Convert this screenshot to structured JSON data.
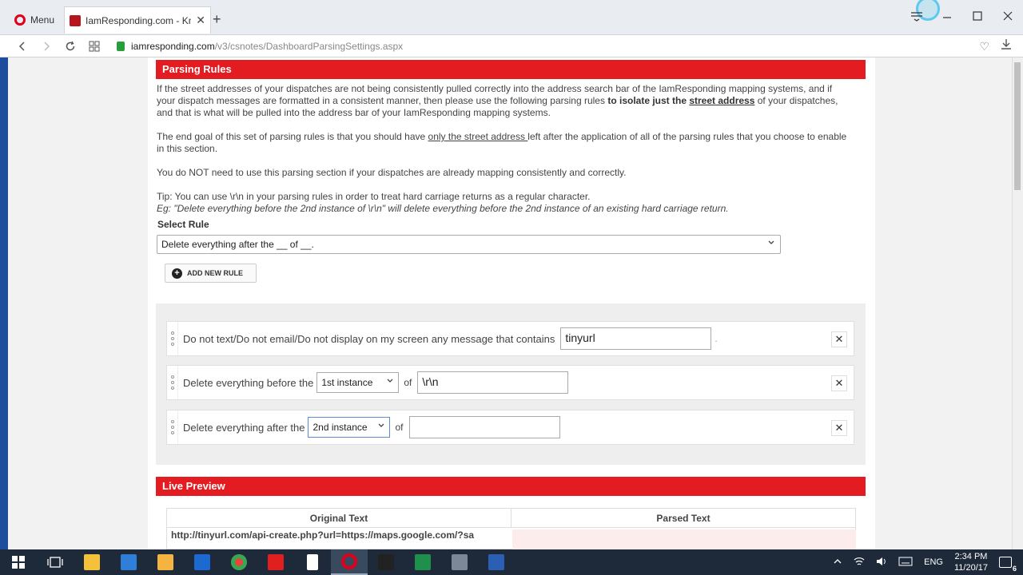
{
  "browser": {
    "menu_label": "Menu",
    "tab_title": "IamResponding.com - Kno",
    "tab_close": "✕",
    "new_tab": "+",
    "url_host": "iamresponding.com",
    "url_path": "/v3/csnotes/DashboardParsingSettings.aspx"
  },
  "parsing": {
    "header": "Parsing Rules",
    "intro": {
      "part1": "If the street addresses of your dispatches are not being consistently pulled correctly into the address search bar of the IamResponding mapping systems, and if your dispatch messages are formatted in a consistent manner, then please use the following parsing rules ",
      "bold": "to isolate just the ",
      "bold_underline": "street address",
      "part2": " of your dispatches, and that is what will be pulled into the address bar of your IamResponding mapping systems."
    },
    "goal": {
      "part1": "The end goal of this set of parsing rules is that you should have ",
      "underline": "only the street address ",
      "part2": "left after the application of all of the parsing rules that you choose to enable in this section."
    },
    "not_needed": "You do NOT need to use this parsing section if your dispatches are already mapping consistently and correctly.",
    "tip": "Tip: You can use \\r\\n in your parsing rules in order to treat hard carriage returns as a regular character.",
    "example": "Eg: \"Delete everything before the 2nd instance of \\r\\n\" will delete everything before the 2nd instance of an existing hard carriage return.",
    "select_label": "Select Rule",
    "select_value": "Delete everything after the __ of __.",
    "add_button": "ADD NEW RULE"
  },
  "rules": [
    {
      "text": "Do not text/Do not email/Do not display on my screen any message that contains",
      "value": "tinyurl",
      "suffix": "."
    },
    {
      "text": "Delete everything before the",
      "instance": "1st instance",
      "of": "of",
      "value": "\\r\\n"
    },
    {
      "text": "Delete everything after the",
      "instance": "2nd instance",
      "of": "of",
      "value": ""
    }
  ],
  "preview": {
    "header": "Live Preview",
    "col_original": "Original Text",
    "col_parsed": "Parsed Text",
    "original_value": "http://tinyurl.com/api-create.php?url=https://maps.google.com/?sa"
  },
  "taskbar": {
    "language": "ENG",
    "time": "2:34 PM",
    "date": "11/20/17",
    "notifications": "6"
  },
  "colors": {
    "header_red": "#e21c21",
    "left_bar": "#1d4e9e",
    "taskbar": "#1e2a3a"
  }
}
